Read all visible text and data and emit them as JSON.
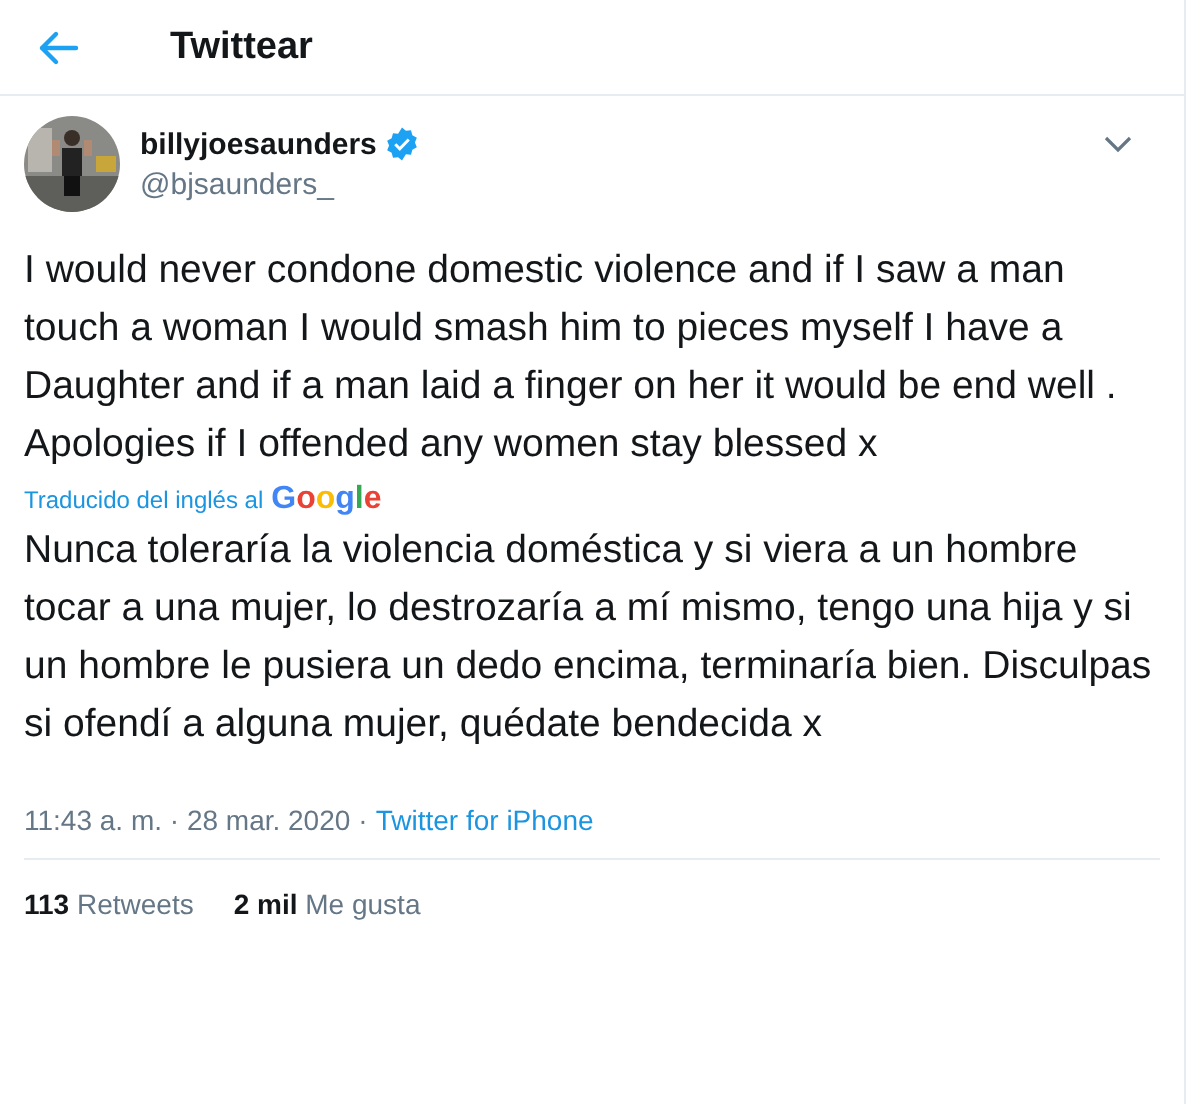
{
  "header": {
    "title": "Twittear"
  },
  "author": {
    "display_name": "billyjoesaunders",
    "verified": true,
    "handle": "@bjsaunders_"
  },
  "tweet": {
    "text": "I would never condone domestic violence and if I saw a man touch a woman I would smash him to  pieces myself I have a Daughter and if a man laid a finger on her it would be end well . Apologies if I offended any women stay blessed x",
    "translation_label": "Traducido del inglés al",
    "translation_provider": "Google",
    "translation": "Nunca toleraría la violencia doméstica y si viera a un hombre tocar a una mujer, lo destrozaría a mí mismo, tengo una hija y si un hombre le pusiera un dedo encima, terminaría bien. Disculpas si ofendí a alguna mujer, quédate bendecida x",
    "time": "11:43 a. m. · 28 mar. 2020",
    "separator": "·",
    "source": "Twitter for iPhone"
  },
  "stats": [
    {
      "count": "113",
      "label": "Retweets"
    },
    {
      "count": "2 mil",
      "label": "Me gusta"
    }
  ]
}
